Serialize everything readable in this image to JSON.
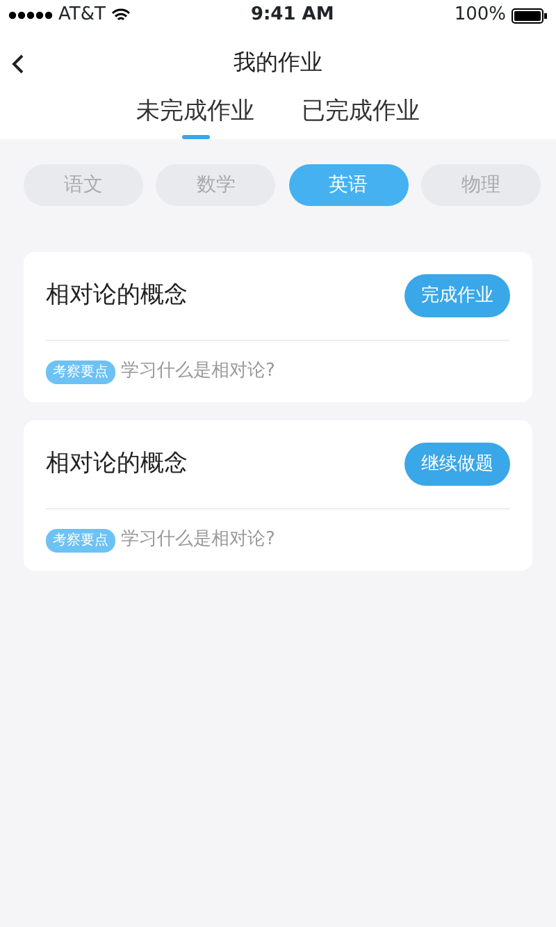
{
  "status_bar": {
    "carrier": "AT&T",
    "time": "9:41 AM",
    "battery": "100%"
  },
  "nav": {
    "title": "我的作业"
  },
  "tabs": [
    {
      "label": "未完成作业",
      "selected": true
    },
    {
      "label": "已完成作业",
      "selected": false
    }
  ],
  "subjects": [
    {
      "label": "语文",
      "selected": false
    },
    {
      "label": "数学",
      "selected": false
    },
    {
      "label": "英语",
      "selected": true
    },
    {
      "label": "物理",
      "selected": false
    }
  ],
  "assignments": [
    {
      "title": "相对论的概念",
      "action": "完成作业",
      "tag": "考察要点",
      "point": "学习什么是相对论?"
    },
    {
      "title": "相对论的概念",
      "action": "继续做题",
      "tag": "考察要点",
      "point": "学习什么是相对论?"
    }
  ]
}
